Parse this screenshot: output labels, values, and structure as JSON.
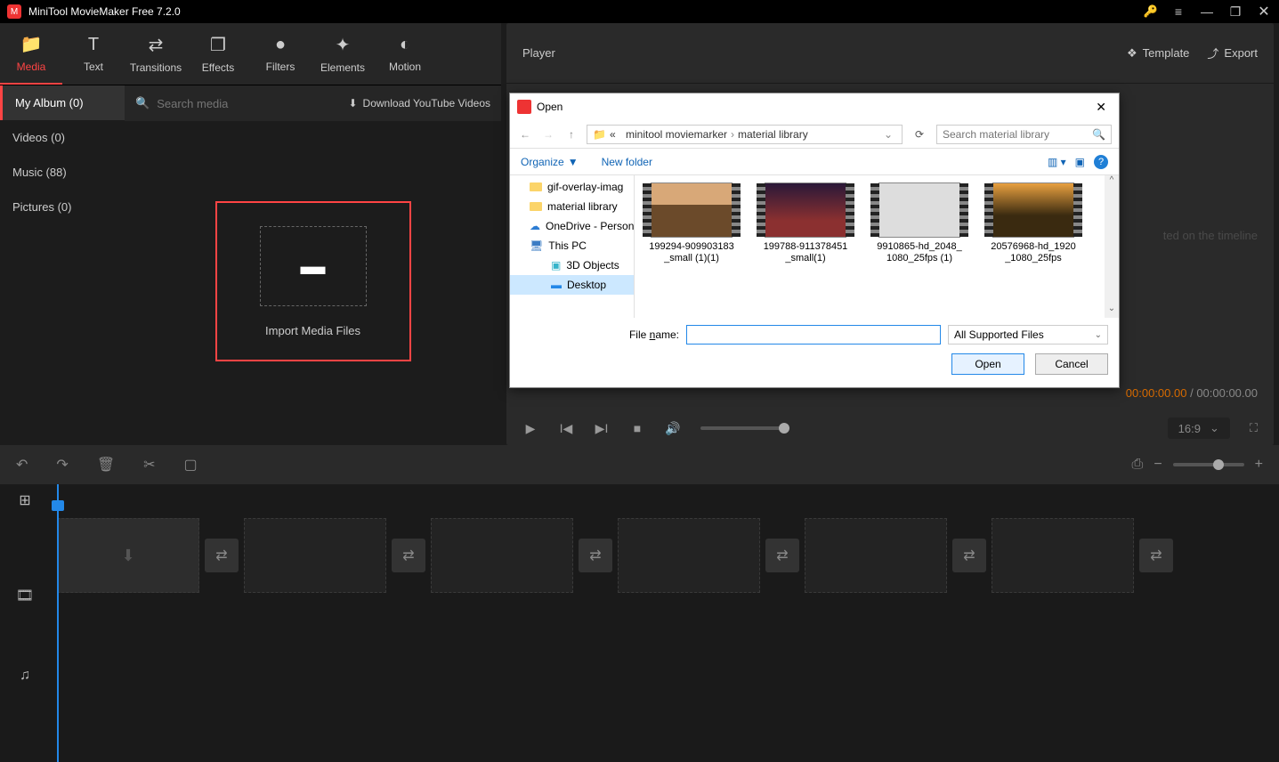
{
  "app": {
    "title": "MiniTool MovieMaker Free 7.2.0"
  },
  "toolbar": {
    "media": "Media",
    "text": "Text",
    "transitions": "Transitions",
    "effects": "Effects",
    "filters": "Filters",
    "elements": "Elements",
    "motion": "Motion"
  },
  "sidebar": {
    "items": [
      {
        "label": "My Album (0)"
      },
      {
        "label": "Videos (0)"
      },
      {
        "label": "Music (88)"
      },
      {
        "label": "Pictures (0)"
      }
    ]
  },
  "search": {
    "placeholder": "Search media"
  },
  "download_youtube": "Download YouTube Videos",
  "import_label": "Import Media Files",
  "player": {
    "title": "Player",
    "template": "Template",
    "export": "Export",
    "preview_msg": "ted on the timeline",
    "time_current": "00:00:00.00",
    "time_total": "00:00:00.00",
    "aspect": "16:9"
  },
  "dialog": {
    "title": "Open",
    "path_prefix": "«",
    "path_a": "minitool moviemarker",
    "path_b": "material library",
    "search_placeholder": "Search material library",
    "organize": "Organize",
    "new_folder": "New folder",
    "tree": {
      "gif": "gif-overlay-imag",
      "material": "material library",
      "onedrive": "OneDrive - Person",
      "thispc": "This PC",
      "threeD": "3D Objects",
      "desktop": "Desktop"
    },
    "files": [
      {
        "name": "199294-909903183_small (1)(1)"
      },
      {
        "name": "199788-911378451_small(1)"
      },
      {
        "name": "9910865-hd_2048_1080_25fps (1)"
      },
      {
        "name": "20576968-hd_1920_1080_25fps"
      }
    ],
    "filename_label": "File name:",
    "filetype": "All Supported Files",
    "open_btn": "Open",
    "cancel_btn": "Cancel"
  }
}
